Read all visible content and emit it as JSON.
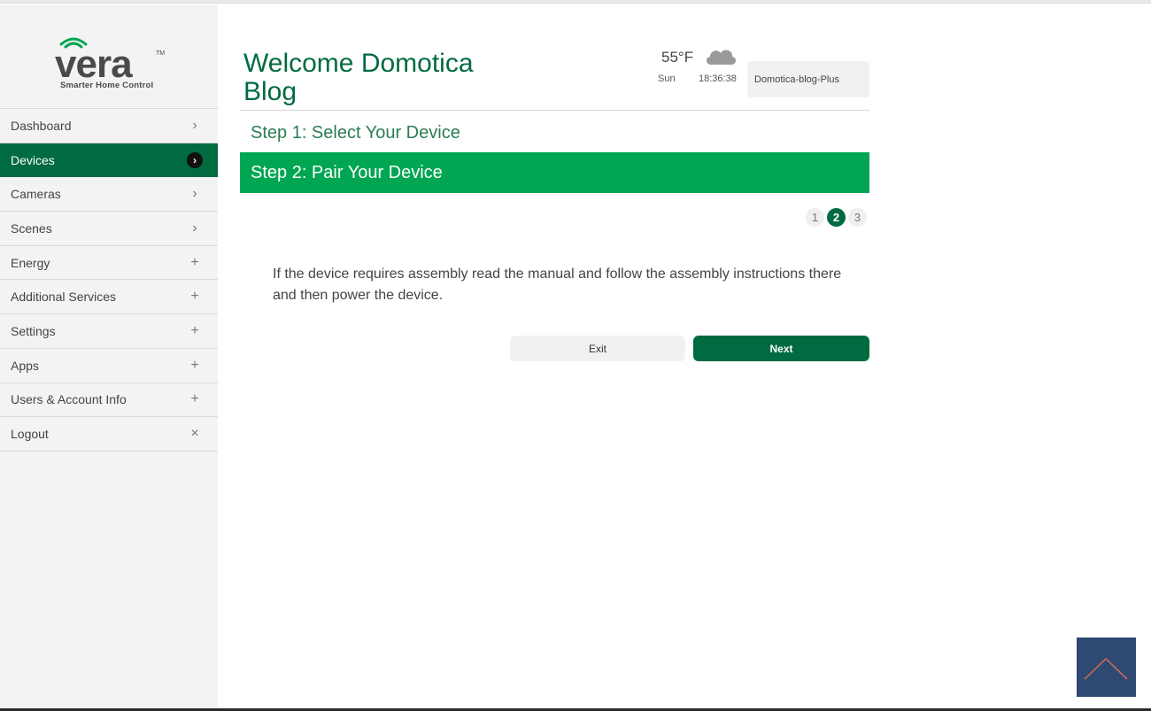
{
  "brand": {
    "name": "Vera",
    "wordmark": "vera",
    "trademark": "TM",
    "tagline": "Smarter Home Control"
  },
  "sidebar": {
    "items": [
      {
        "label": "Dashboard",
        "icon": "chevron-right-icon",
        "glyph": "›"
      },
      {
        "label": "Devices",
        "icon": "chevron-right-icon",
        "glyph": "›",
        "active": true
      },
      {
        "label": "Cameras",
        "icon": "chevron-right-icon",
        "glyph": "›"
      },
      {
        "label": "Scenes",
        "icon": "chevron-right-icon",
        "glyph": "›"
      },
      {
        "label": "Energy",
        "icon": "plus-icon",
        "glyph": "+"
      },
      {
        "label": "Additional Services",
        "icon": "plus-icon",
        "glyph": "+"
      },
      {
        "label": "Settings",
        "icon": "plus-icon",
        "glyph": "+"
      },
      {
        "label": "Apps",
        "icon": "plus-icon",
        "glyph": "+"
      },
      {
        "label": "Users & Account Info",
        "icon": "plus-icon",
        "glyph": "+"
      },
      {
        "label": "Logout",
        "icon": "close-icon",
        "glyph": "×"
      }
    ]
  },
  "header": {
    "welcome": "Welcome Domotica Blog",
    "weather": {
      "temperature": "55°F",
      "icon": "cloud-icon",
      "day": "Sun",
      "time": "18:36:38"
    },
    "account": "Domotica-blog-Plus"
  },
  "wizard": {
    "step1_title": "Step 1: Select Your Device",
    "step2_title": "Step 2: Pair Your Device",
    "pages": [
      "1",
      "2",
      "3"
    ],
    "current_page": "2",
    "instructions": "If the device requires assembly read the manual and follow the assembly instructions there and then power the device.",
    "exit_label": "Exit",
    "next_label": "Next"
  },
  "colors": {
    "brand_green": "#006b40",
    "active_step_green": "#00a651",
    "scroll_top_bg": "#2e4a73"
  }
}
